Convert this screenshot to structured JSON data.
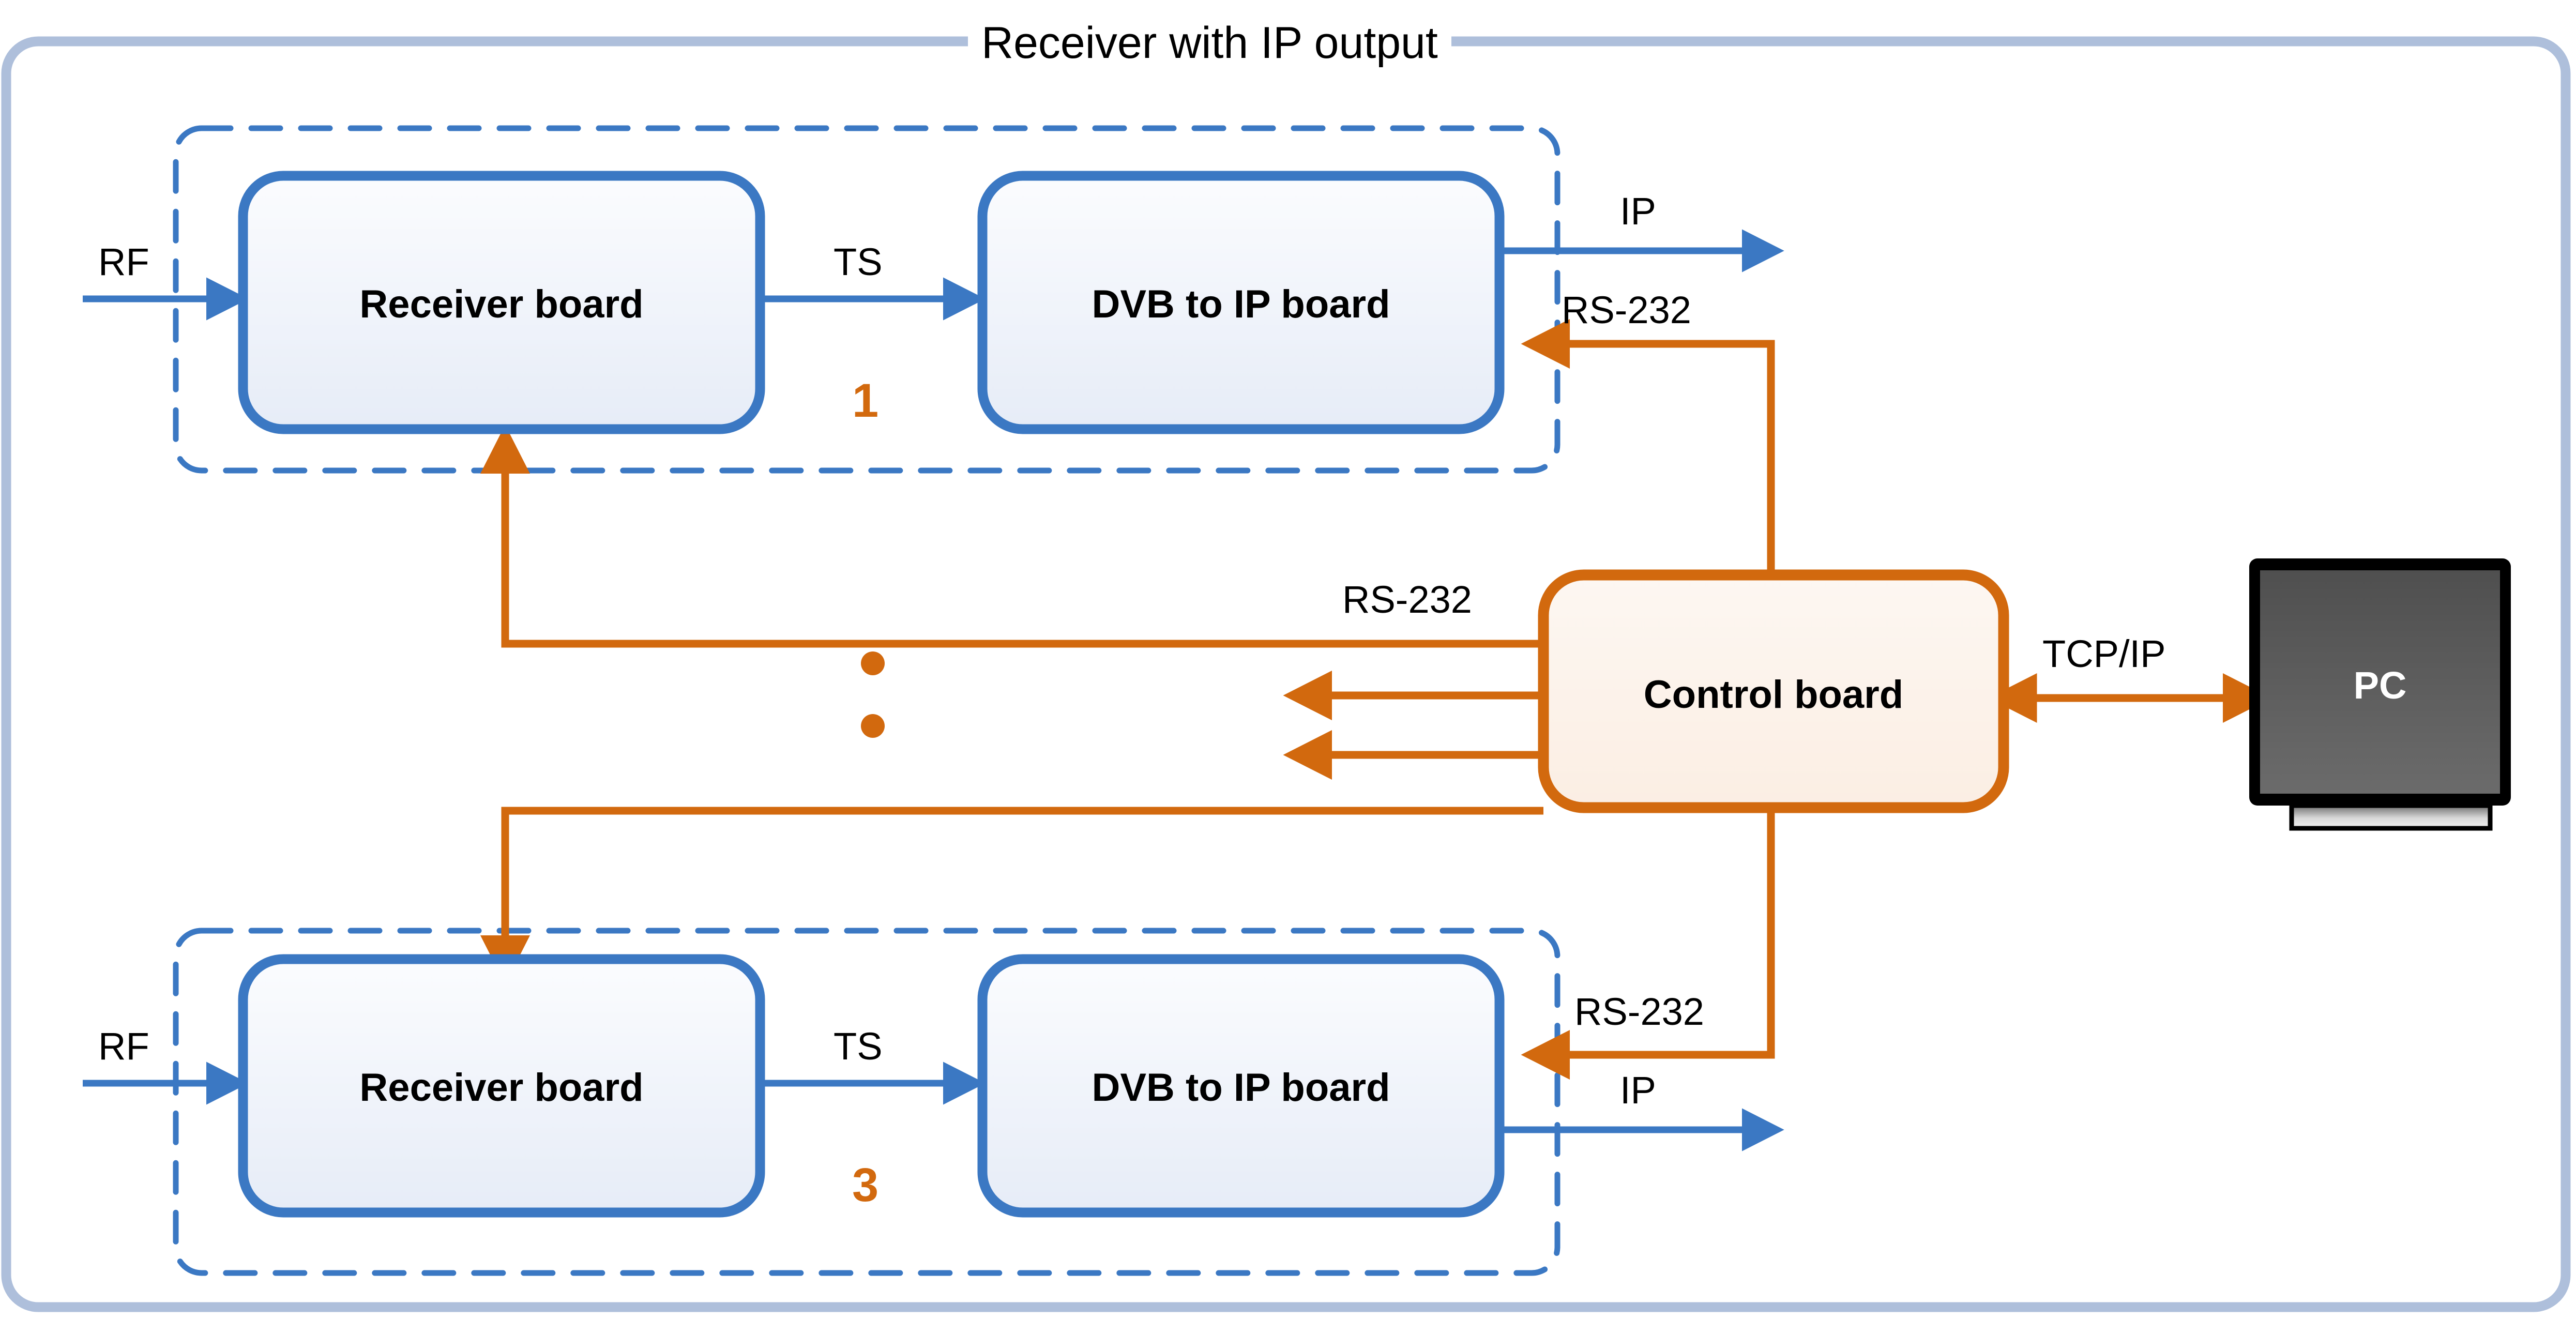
{
  "frame": {
    "title": "Receiver with IP output",
    "border_color": "#aebfdb"
  },
  "colors": {
    "blue_signal": "#3b78c3",
    "blue_box_border": "#3b78c3",
    "blue_box_fill_top": "#fbfcfe",
    "blue_box_fill_bottom": "#e8edf6",
    "orange_signal": "#d2690e",
    "orange_box_border": "#d2690e",
    "orange_box_fill": "#fcf3ec",
    "dashed_group": "#3b78c3",
    "pc_bezel": "#000000",
    "pc_screen": "#5a5a5a",
    "text": "#000000"
  },
  "groups": [
    {
      "index_label": "1",
      "blocks": [
        {
          "label": "Receiver board"
        },
        {
          "label": "DVB to IP board"
        }
      ],
      "signals": {
        "rf_in": "RF",
        "ts": "TS",
        "ip_out": "IP",
        "rs232_in": "RS-232"
      }
    },
    {
      "index_label": "3",
      "blocks": [
        {
          "label": "Receiver board"
        },
        {
          "label": "DVB to IP board"
        }
      ],
      "signals": {
        "rf_in": "RF",
        "ts": "TS",
        "ip_out": "IP",
        "rs232_in": "RS-232"
      }
    }
  ],
  "control_board": {
    "label": "Control board",
    "bus_label": "RS-232"
  },
  "host": {
    "label": "PC",
    "link_label": "TCP/IP"
  },
  "ellipsis": {
    "dot_count": "2"
  }
}
